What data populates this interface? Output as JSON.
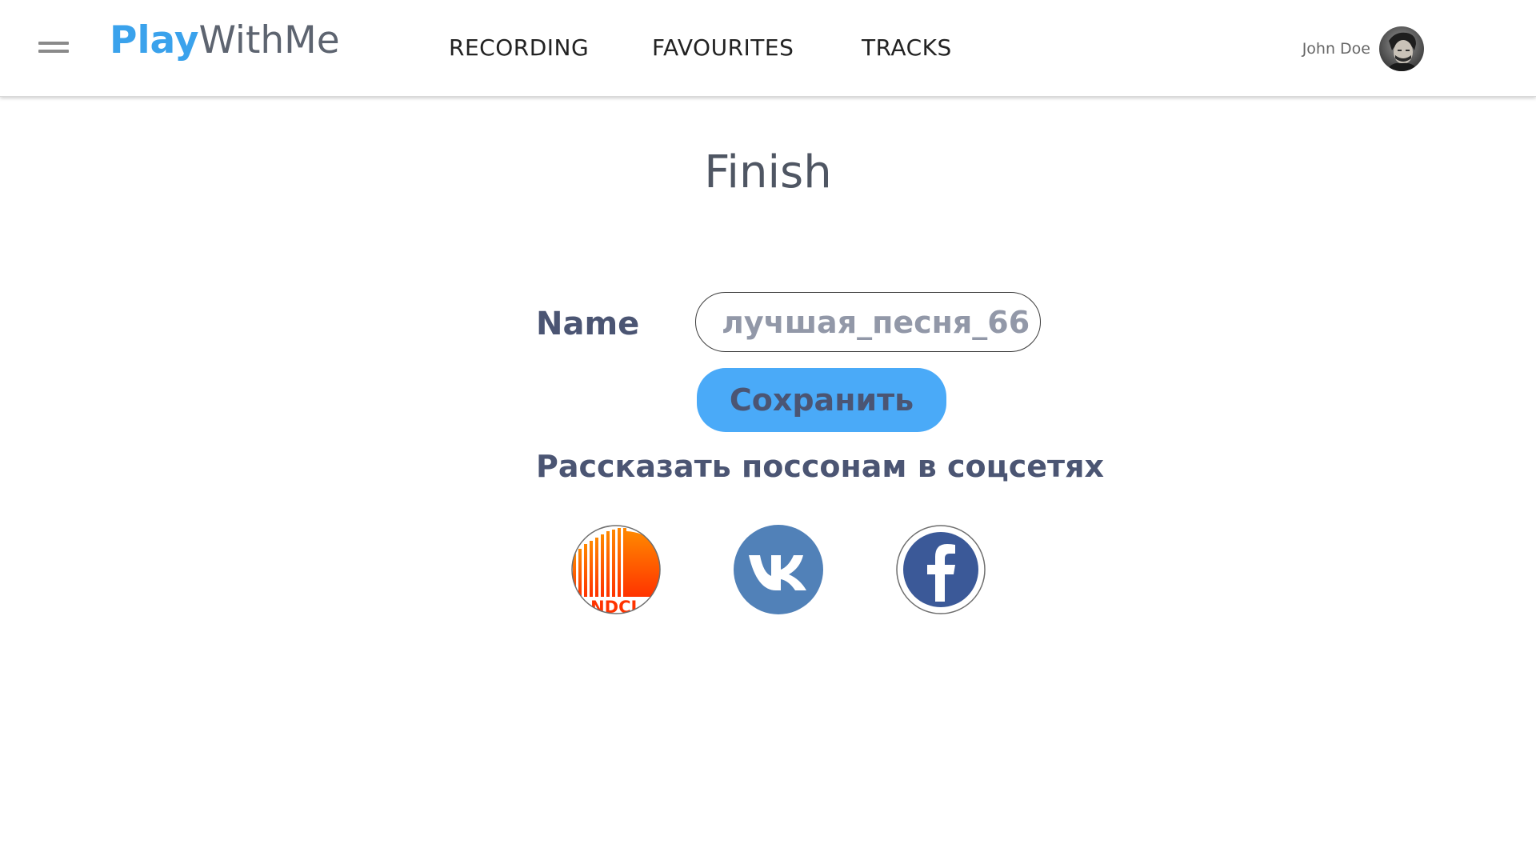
{
  "header": {
    "logo": {
      "part1": "Play",
      "part2": "WithMe"
    },
    "nav": [
      {
        "label": "RECORDING"
      },
      {
        "label": "FAVOURITES"
      },
      {
        "label": "TRACKS"
      }
    ],
    "user": {
      "name": "John Doe"
    }
  },
  "main": {
    "title": "Finish",
    "name_label": "Name",
    "name_input": {
      "value": "",
      "placeholder": "лучшая_песня_66"
    },
    "save_button": "Сохранить",
    "share_label": "Рассказать поссонам в соцсетях",
    "social": [
      {
        "name": "soundcloud",
        "icon": "soundcloud-icon",
        "partial_text": "NDCL"
      },
      {
        "name": "vk",
        "icon": "vk-icon"
      },
      {
        "name": "facebook",
        "icon": "facebook-icon"
      }
    ]
  },
  "colors": {
    "brand_blue": "#3aa2ec",
    "button_blue": "#4aaaf8",
    "text_dark": "#4b5573",
    "vk_blue": "#5181b8",
    "facebook_blue": "#3b5998",
    "soundcloud_orange": "#ff5500"
  }
}
